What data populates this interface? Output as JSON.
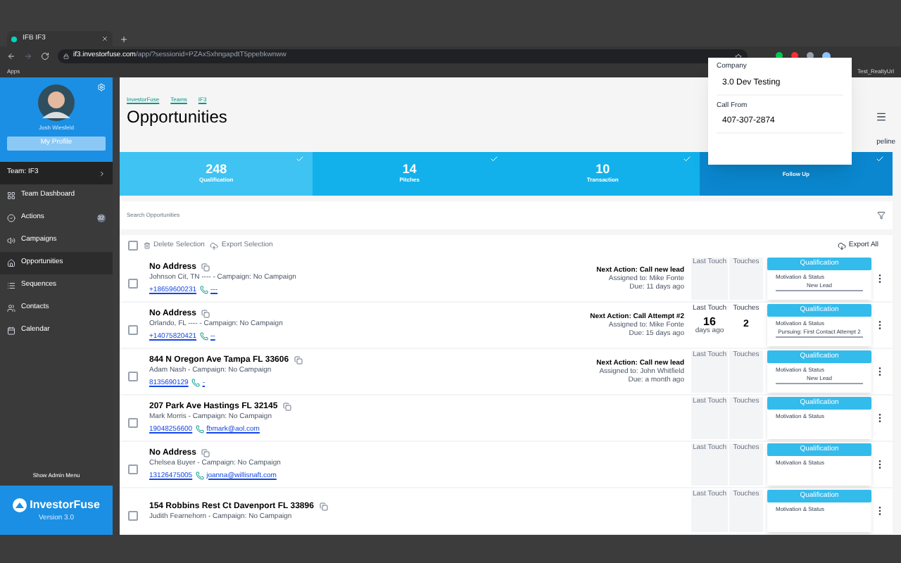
{
  "browser": {
    "tab_title": "IFB IF3",
    "url_host": "if3.investorfuse.com",
    "url_path": "/app/?sessionid=PZAxSxhngapdtT5ppebkwnww",
    "bookmark": "Apps",
    "profile_label": "Test_RealtyUrl"
  },
  "sidebar": {
    "user_name": "Josh Wiesfeld",
    "profile_button": "My Profile",
    "team": "Team: IF3",
    "items": [
      {
        "label": "Team Dashboard",
        "kind": "grid",
        "selected": false
      },
      {
        "label": "Actions",
        "kind": "check",
        "selected": false,
        "badge": "32"
      },
      {
        "label": "Campaigns",
        "kind": "speaker",
        "selected": false
      },
      {
        "label": "Opportunities",
        "kind": "home",
        "selected": true
      },
      {
        "label": "Sequences",
        "kind": "list",
        "selected": false
      },
      {
        "label": "Contacts",
        "kind": "people",
        "selected": false
      },
      {
        "label": "Calendar",
        "kind": "calendar",
        "selected": false
      }
    ],
    "admin_link": "Show Admin Menu",
    "logo_text": "InvestorFuse",
    "logo_sub": "Version 3.0"
  },
  "breadcrumbs": [
    "InvestorFuse",
    "Teams",
    "IF3"
  ],
  "page_title": "Opportunities",
  "pipeline_label": "peline",
  "stages": [
    {
      "count": "248",
      "label": "Qualification",
      "selected": false
    },
    {
      "count": "14",
      "label": "Pitches",
      "selected": false
    },
    {
      "count": "10",
      "label": "Transaction",
      "selected": false
    },
    {
      "label": "Follow Up",
      "selected": true
    }
  ],
  "popup": {
    "fields": [
      {
        "label": "Company",
        "value": "3.0 Dev Testing"
      },
      {
        "label": "Call From",
        "value": "407-307-2874"
      }
    ]
  },
  "search": {
    "placeholder": "Search Opportunities"
  },
  "toolbar": {
    "select_all_checked": false,
    "delete": "Delete Selection",
    "export": "Export Selection",
    "export_all": "Export All"
  },
  "rows": [
    {
      "checked": false,
      "address": "No Address",
      "details": "Johnson Cit, TN ---- - Campaign: No Campaign",
      "phone": "+18659600231",
      "email": "---",
      "next_action": "Next Action: Call new lead",
      "assigned": "Assigned to: Mike Fonte",
      "due": "Due: 11 days ago",
      "last_touch_label": "Last Touch",
      "touches_label": "Touches",
      "stage": "Qualification",
      "motivation": "Motivation & Status",
      "status": "New Lead"
    },
    {
      "checked": false,
      "address": "No Address",
      "details": "Orlando, FL ---- - Campaign: No Campaign",
      "phone": "+14075820421",
      "email": "--",
      "next_action": "Next Action: Call Attempt #2",
      "assigned": "Assigned to: Mike Fonte",
      "due": "Due: 15 days ago",
      "last_touch_label": "Last Touch",
      "touches_label": "Touches",
      "last_touch": "16",
      "last_touch_sub": "days ago",
      "touches": "2",
      "stage": "Qualification",
      "motivation": "Motivation & Status",
      "status": "Pursuing: First Contact Attempt 2"
    },
    {
      "checked": false,
      "address": "844 N Oregon Ave Tampa FL 33606",
      "details": "Adam Nash - Campaign: No Campaign",
      "phone": "8135690129",
      "email": "-",
      "next_action": "Next Action: Call new lead",
      "assigned": "Assigned to: John Whitfield",
      "due": "Due: a month ago",
      "last_touch_label": "Last Touch",
      "touches_label": "Touches",
      "stage": "Qualification",
      "motivation": "Motivation & Status",
      "status": "New Lead"
    },
    {
      "checked": false,
      "address": "207 Park Ave Hastings FL 32145",
      "details": "Mark Morris - Campaign: No Campaign",
      "phone": "19048256600",
      "email": "fbmark@aol.com",
      "last_touch_label": "Last Touch",
      "touches_label": "Touches",
      "stage": "Qualification",
      "motivation": "Motivation & Status"
    },
    {
      "checked": false,
      "address": "No Address",
      "details": "Chelsea Buyer - Campaign: No Campaign",
      "phone": "13126475005",
      "email": "joanna@willisnaft.com",
      "last_touch_label": "Last Touch",
      "touches_label": "Touches",
      "stage": "Qualification",
      "motivation": "Motivation & Status"
    },
    {
      "checked": false,
      "address": "154 Robbins Rest Ct Davenport FL 33896",
      "details": "Judith Fearnehorn - Campaign: No Campaign",
      "last_touch_label": "Last Touch",
      "touches_label": "Touches",
      "stage": "Qualification",
      "motivation": "Motivation & Status"
    }
  ]
}
